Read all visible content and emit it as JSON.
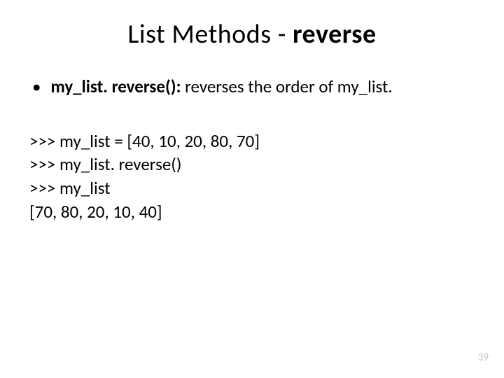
{
  "title": {
    "prefix": "List Methods - ",
    "bold": "reverse"
  },
  "bullet": {
    "method": "my_list. reverse():",
    "description": " reverses the order of my_list."
  },
  "code": {
    "line1": ">>> my_list = [40, 10, 20, 80, 70]",
    "line2": ">>> my_list. reverse()",
    "line3": ">>> my_list",
    "line4": "[70, 80, 20, 10, 40]"
  },
  "page_number": "39"
}
